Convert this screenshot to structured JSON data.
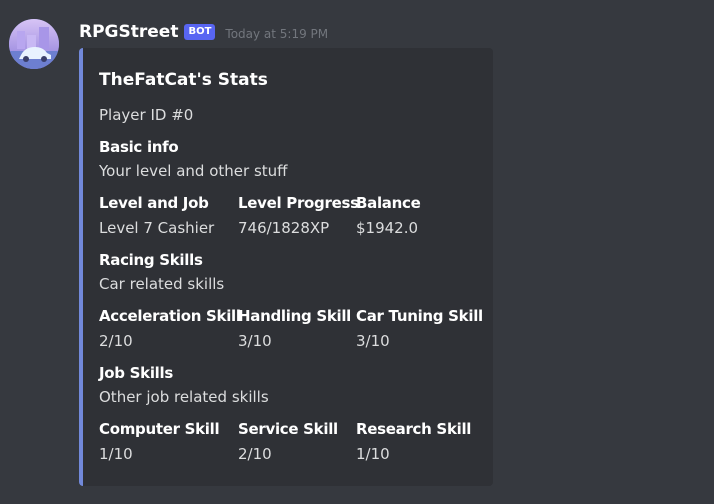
{
  "message": {
    "username": "RPGStreet",
    "badge": "BOT",
    "timestamp": "Today at 5:19 PM"
  },
  "embed": {
    "accent_color": "#7289da",
    "title": "TheFatCat's Stats",
    "description": "Player ID #0",
    "fields": [
      {
        "name": "Basic info",
        "value": "Your level and other stuff"
      },
      {
        "name": "Level and Job",
        "value": "Level 7 Cashier"
      },
      {
        "name": "Level Progress",
        "value": "746/1828XP"
      },
      {
        "name": "Balance",
        "value": "$1942.0"
      },
      {
        "name": "Racing Skills",
        "value": "Car related skills"
      },
      {
        "name": "Acceleration Skill",
        "value": "2/10"
      },
      {
        "name": "Handling Skill",
        "value": "3/10"
      },
      {
        "name": "Car Tuning Skill",
        "value": "3/10"
      },
      {
        "name": "Job Skills",
        "value": "Other job related skills"
      },
      {
        "name": "Computer Skill",
        "value": "1/10"
      },
      {
        "name": "Service Skill",
        "value": "2/10"
      },
      {
        "name": "Research Skill",
        "value": "1/10"
      }
    ]
  }
}
